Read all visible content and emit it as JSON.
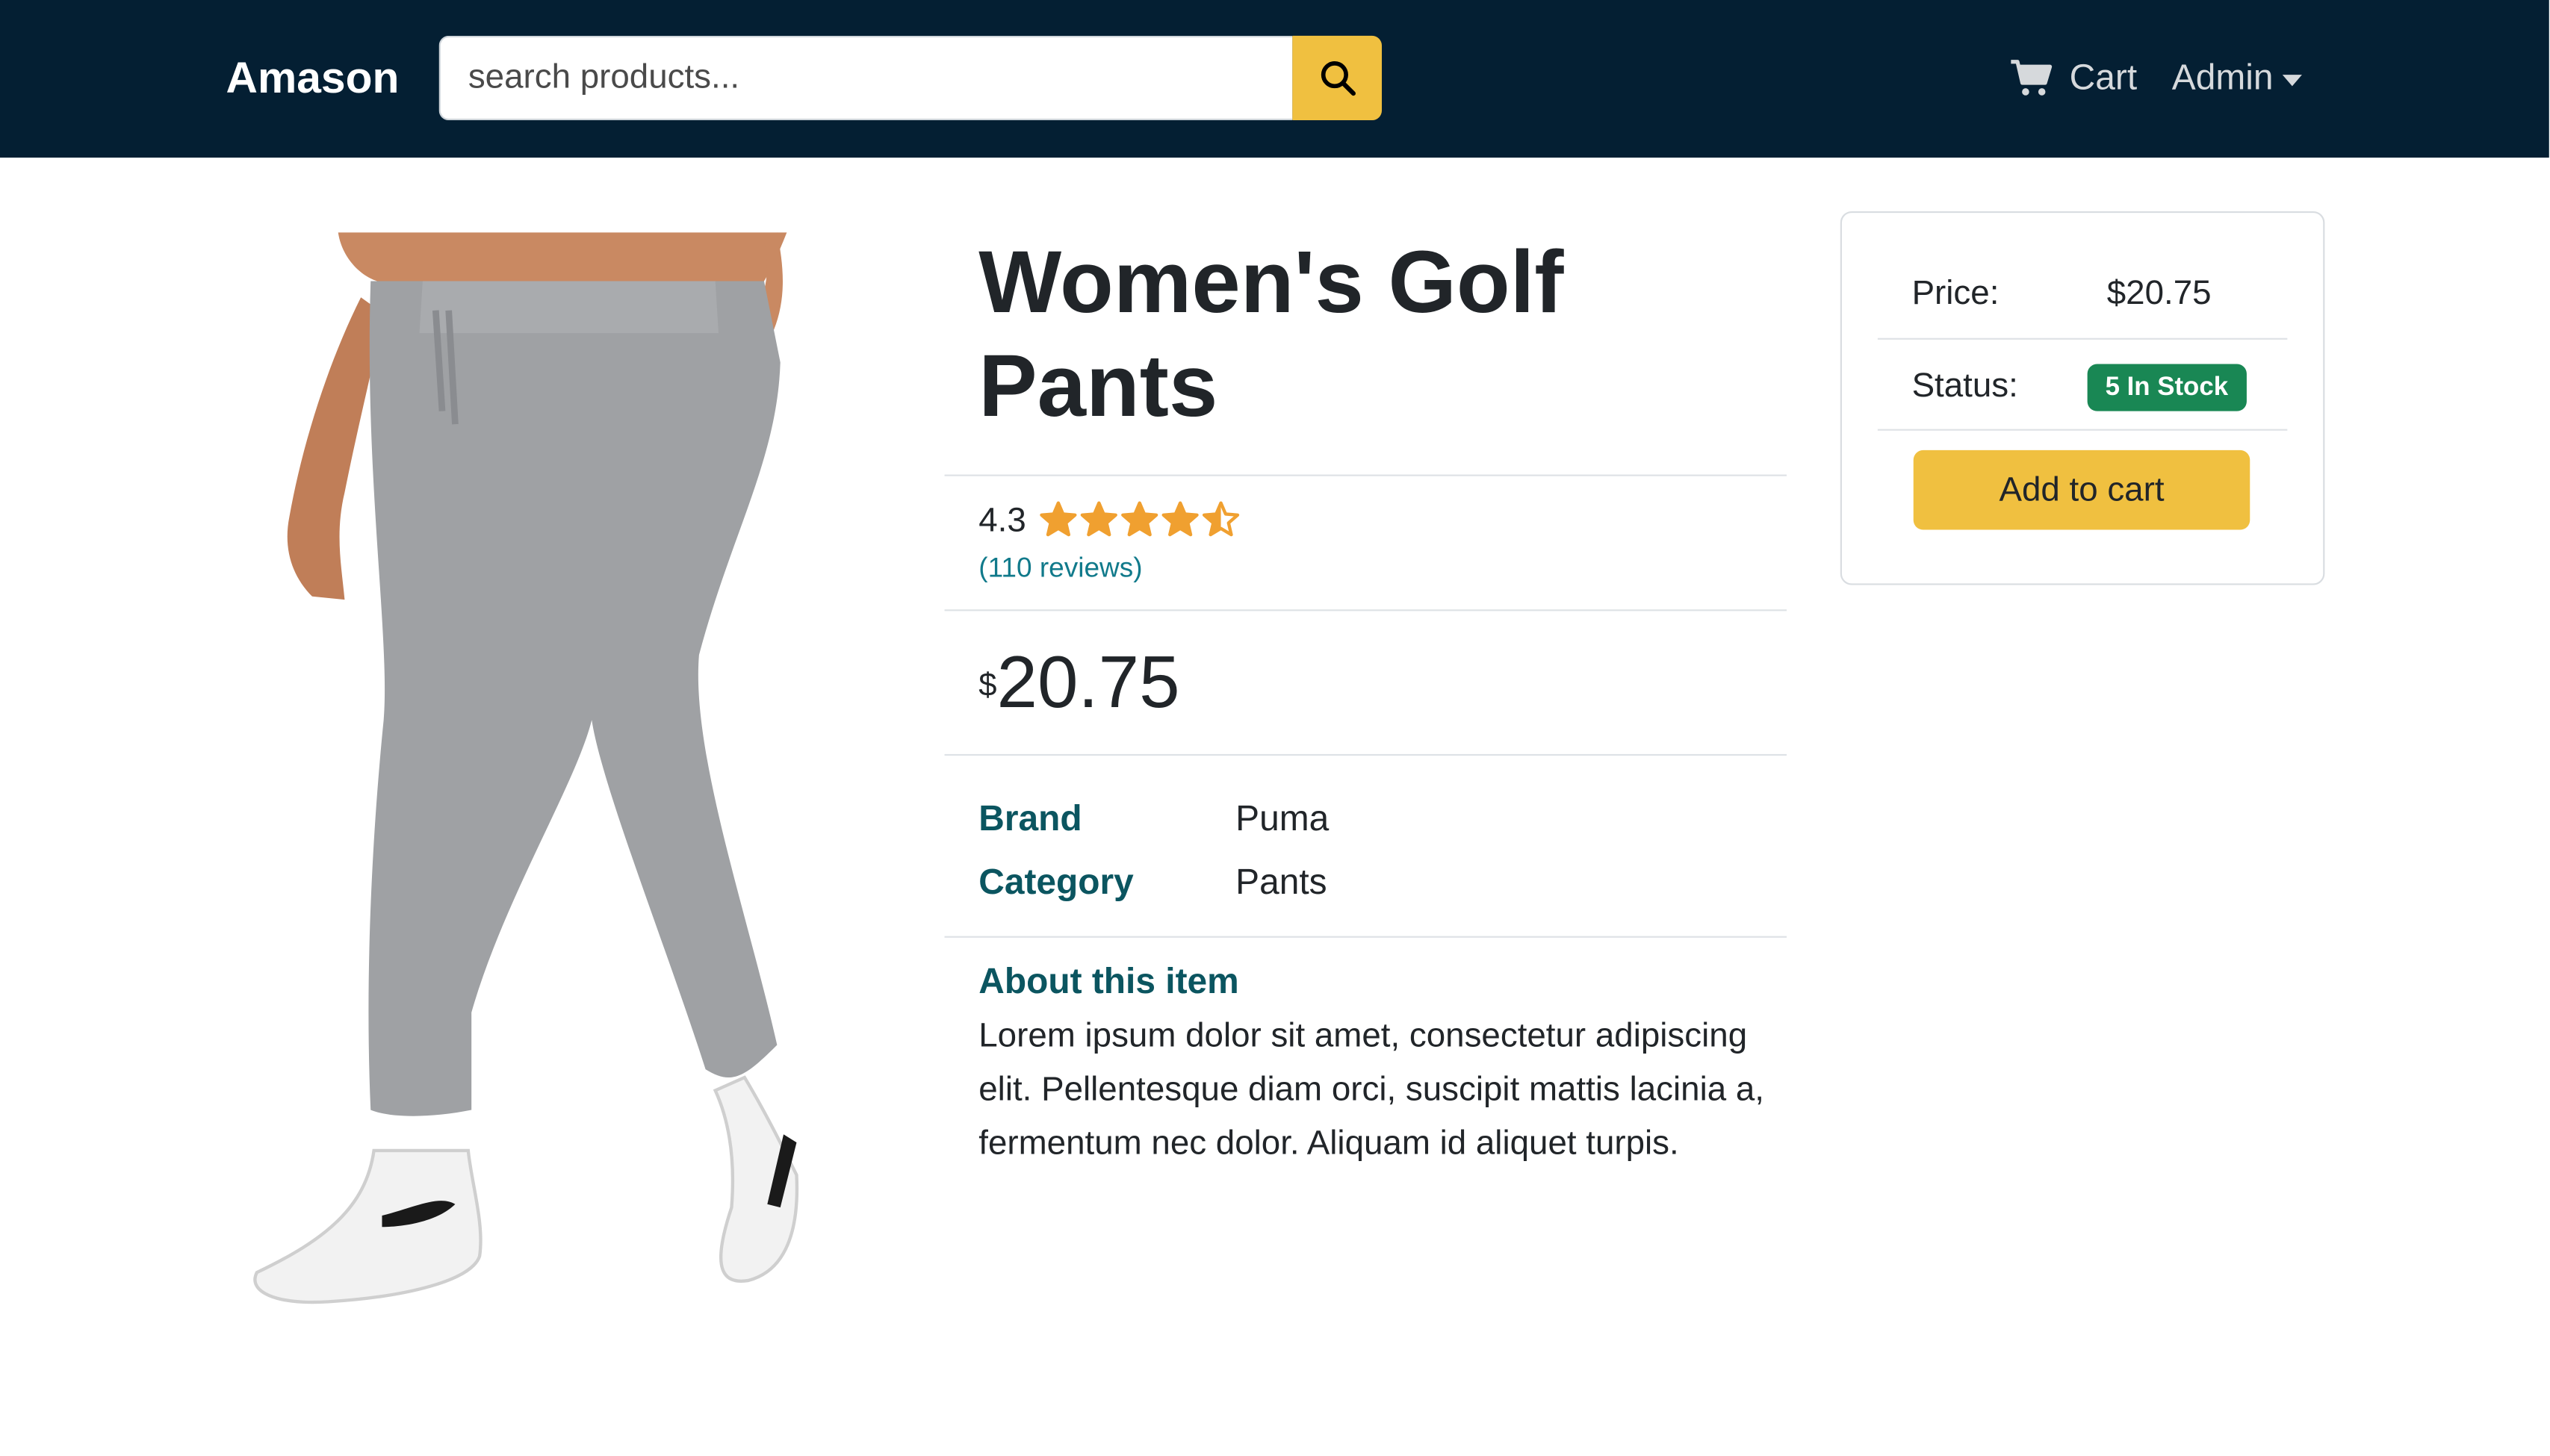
{
  "navbar": {
    "brand": "Amason",
    "search_placeholder": "search products...",
    "search_icon": "search-icon",
    "cart_label": "Cart",
    "cart_icon": "shopping-cart-icon",
    "admin_label": "Admin",
    "colors": {
      "background": "#041f33",
      "accent": "#f0c040"
    }
  },
  "product": {
    "name": "Women's Golf Pants",
    "rating": "4.3",
    "rating_value": 4.3,
    "reviews_text": "(110 reviews)",
    "price_currency": "$",
    "price_amount": "20.75",
    "specs": [
      {
        "label": "Brand",
        "value": "Puma"
      },
      {
        "label": "Category",
        "value": "Pants"
      }
    ],
    "about_heading": "About this item",
    "about_text": "Lorem ipsum dolor sit amet, consectetur adipiscing elit. Pellentesque diam orci, suscipit mattis lacinia a, fermentum nec dolor. Aliquam id aliquet turpis.",
    "image_icon": "product-photo-golf-pants"
  },
  "buy_box": {
    "price_label": "Price:",
    "price_value": "$20.75",
    "status_label": "Status:",
    "status_badge": "5 In Stock",
    "add_to_cart": "Add to cart",
    "colors": {
      "badge": "#198754",
      "button": "#f0c040",
      "star": "#f0a030"
    }
  }
}
